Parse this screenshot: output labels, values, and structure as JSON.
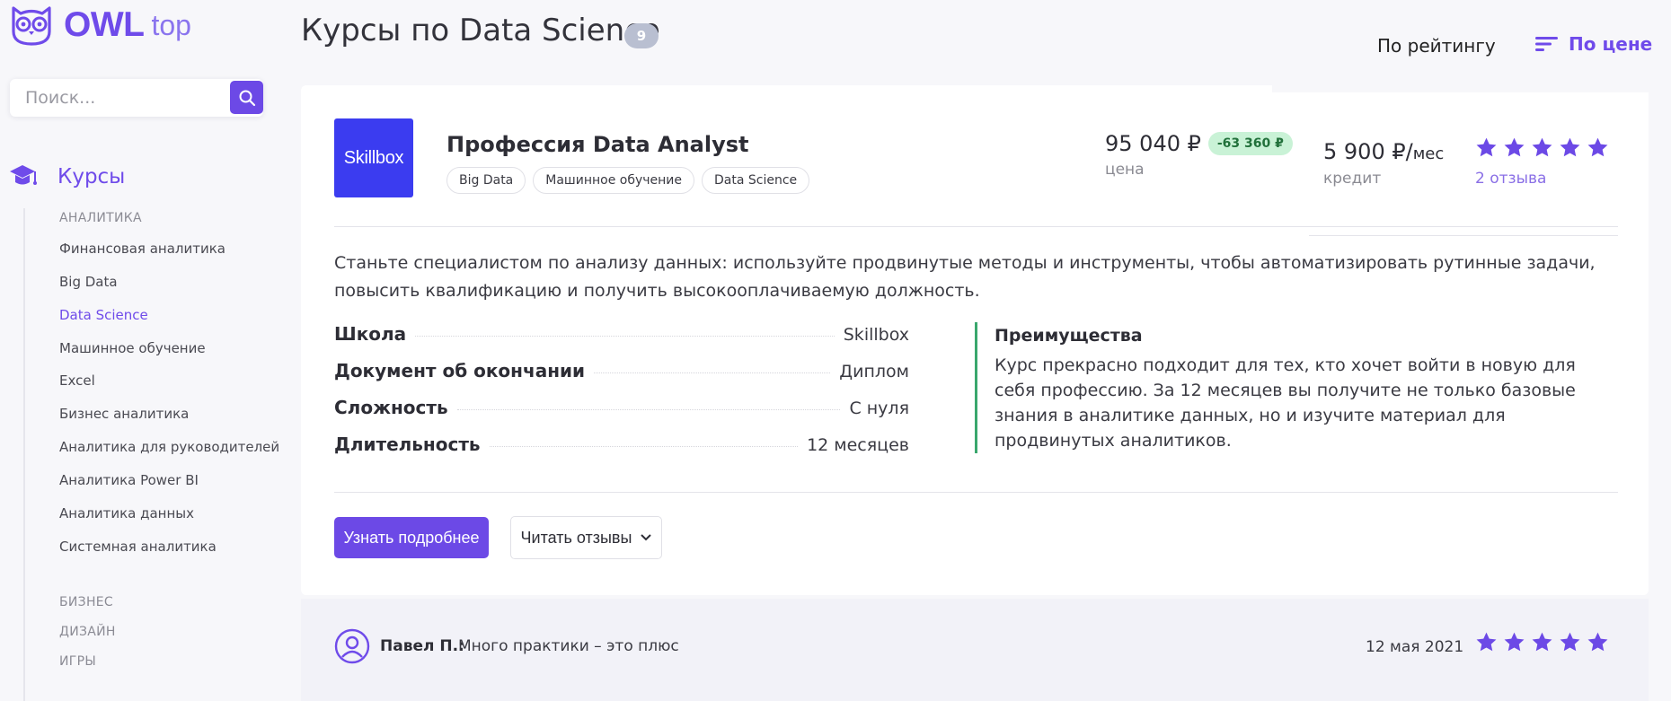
{
  "logo": {
    "brand": "OWL",
    "sub": "top"
  },
  "search": {
    "placeholder": "Поиск..."
  },
  "sidebar": {
    "courses_label": "Курсы",
    "section": "АНАЛИТИКА",
    "items": [
      {
        "label": "Финансовая аналитика"
      },
      {
        "label": "Big Data"
      },
      {
        "label": "Data Science"
      },
      {
        "label": "Машинное обучение"
      },
      {
        "label": "Excel"
      },
      {
        "label": "Бизнес аналитика"
      },
      {
        "label": "Аналитика для руководителей"
      },
      {
        "label": "Аналитика Power BI"
      },
      {
        "label": "Аналитика данных"
      },
      {
        "label": "Системная аналитика"
      }
    ],
    "categories": [
      "БИЗНЕС",
      "ДИЗАЙН",
      "ИГРЫ"
    ]
  },
  "header": {
    "title": "Курсы по Data Science",
    "count": "9",
    "sort_rating": "По рейтингу",
    "sort_price": "По цене"
  },
  "course": {
    "school_logo": "Skillbox",
    "title": "Профессия Data Analyst",
    "tags": [
      "Big Data",
      "Машинное обучение",
      "Data Science"
    ],
    "price": "95 040 ₽",
    "discount": "-63 360 ₽",
    "price_label": "цена",
    "credit": "5 900 ₽/",
    "credit_unit": "мес",
    "credit_label": "кредит",
    "rating": 5,
    "reviews": "2 отзыва",
    "description": "Станьте специалистом по анализу данных: используйте продвинутые методы и инструменты, чтобы автоматизировать рутинные задачи, повысить квалификацию и получить высокооплачиваемую должность.",
    "facts": [
      {
        "key": "Школа",
        "value": "Skillbox"
      },
      {
        "key": "Документ об окончании",
        "value": "Диплом"
      },
      {
        "key": "Сложность",
        "value": "С нуля"
      },
      {
        "key": "Длительность",
        "value": "12 месяцев"
      }
    ],
    "advantages_title": "Преимущества",
    "advantages_text": "Курс прекрасно подходит для тех, кто хочет войти в новую для себя профессию. За 12 месяцев вы получите не только базовые знания в аналитике данных, но и изучите материал для продвинутых аналитиков.",
    "btn_more": "Узнать подробнее",
    "btn_reviews": "Читать отзывы"
  },
  "review": {
    "author": "Павел П.:",
    "text": "Много практики – это плюс",
    "date": "12 мая 2021",
    "rating": 5
  },
  "colors": {
    "accent": "#6c49e6",
    "school_brand": "#3b3cf0",
    "discount_bg": "#c9f2d6",
    "advantage_border": "#3aa76d"
  }
}
